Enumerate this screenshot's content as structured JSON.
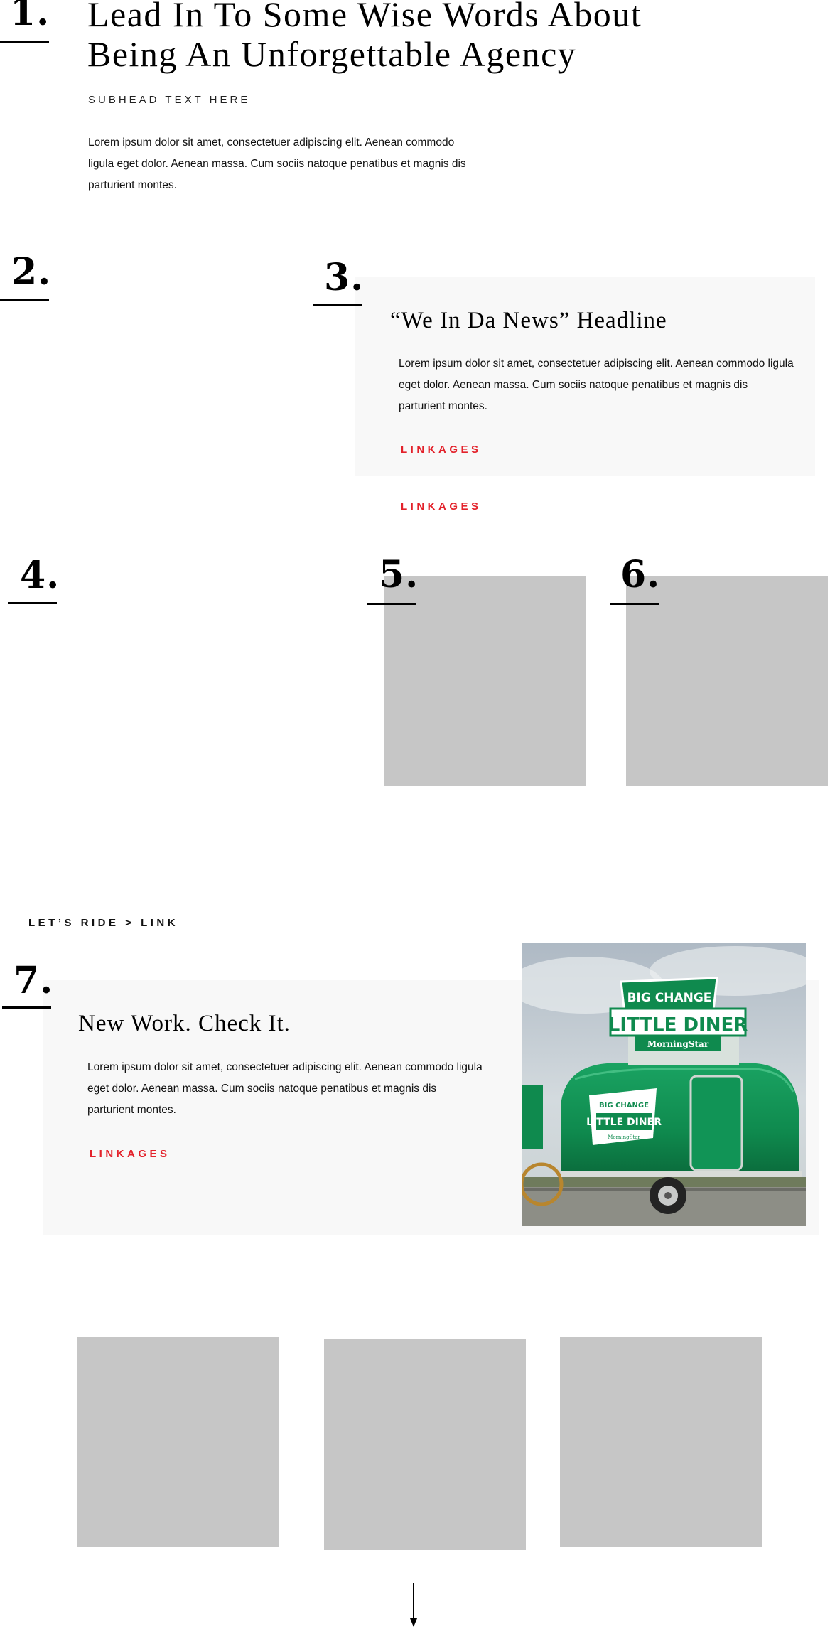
{
  "section1": {
    "number": "1.",
    "headline_line1": "Lead In To Some Wise Words About",
    "headline_line2": "Being An Unforgettable Agency",
    "subhead": "SUBHEAD TEXT HERE",
    "body": "Lorem ipsum dolor sit amet, consectetuer adipiscing elit. Aenean commodo ligula eget dolor. Aenean massa. Cum sociis natoque penatibus et magnis dis parturient montes."
  },
  "section2": {
    "number": "2."
  },
  "section3": {
    "number": "3.",
    "headline": "“We In Da News” Headline",
    "body": "Lorem ipsum dolor sit amet, consectetuer adipiscing elit. Aenean commodo ligula eget dolor. Aenean massa. Cum sociis natoque penatibus et magnis dis parturient montes.",
    "link_inside": "LINKAGES",
    "link_outside": "LINKAGES"
  },
  "section4": {
    "number": "4."
  },
  "section5": {
    "number": "5."
  },
  "section6": {
    "number": "6."
  },
  "ride_link": "LET’S RIDE > LINK",
  "section7": {
    "number": "7.",
    "headline": "New Work. Check It.",
    "body": "Lorem ipsum dolor sit amet, consectetuer adipiscing elit. Aenean commodo ligula eget dolor. Aenean massa. Cum sociis natoque penatibus et magnis dis parturient montes.",
    "link": "LINKAGES",
    "photo": {
      "sign_top": "BIG CHANGE",
      "sign_main": "LITTLE DINER",
      "sign_brand": "MorningStar",
      "trailer_top": "BIG CHANGE",
      "trailer_main": "LITTLE DINER",
      "trailer_brand": "MorningStar"
    }
  },
  "colors": {
    "accent_red": "#e3222b",
    "panel_gray": "#f8f8f8",
    "placeholder_gray": "#c6c6c6",
    "trailer_green": "#0f8a4e"
  },
  "icons": {
    "scroll_indicator": "arrow-down-icon"
  }
}
